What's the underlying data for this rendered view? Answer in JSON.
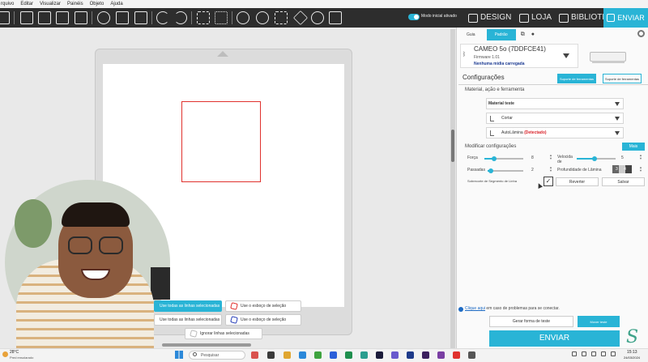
{
  "menubar": {
    "items": [
      "rquivo",
      "Editar",
      "Visualizar",
      "Painéis",
      "Objeto",
      "Ajuda"
    ]
  },
  "toolbar": {
    "icons": [
      "home-icon",
      "new-file-icon",
      "open-folder-icon",
      "save-icon",
      "print-icon",
      "cut-icon",
      "copy-icon",
      "paste-icon",
      "undo-icon",
      "redo-icon",
      "group-icon",
      "ungroup-icon",
      "zoom-in-icon",
      "zoom-out-icon",
      "zoom-fit-icon",
      "fill-page-icon",
      "pan-hand-icon",
      "move-icon"
    ],
    "mode_label": "Modo inicial ativado",
    "tabs": {
      "design": "DESIGN",
      "store": "LOJA",
      "library": "BIBLIOTECA",
      "send": "ENVIAR"
    }
  },
  "context_menu": {
    "items": [
      "Use todas as linhas selecionadas",
      "Use o esboço de seleção",
      "Use todas as linhas selecionadas",
      "Use o esboço de seleção",
      "Ignorar linhas selecionadas"
    ]
  },
  "panel": {
    "tabs": [
      "Guia",
      "Padrão"
    ],
    "device": {
      "name": "CAMEO 5o (7DDFCE41)",
      "firmware": "Firmware 1.01",
      "media": "Nenhuma mídia carregada"
    },
    "config_title": "Configurações",
    "tool_tabs": [
      "Suporte de ferramentas",
      "Suporte de ferramentas"
    ],
    "material_section": "Material, ação e ferramenta",
    "material": "Material teste",
    "action": "Cortar",
    "tool_name": "AutoLâmina",
    "tool_detected": "(Detectado)",
    "modify_title": "Modificar configurações",
    "more_button": "Mais",
    "force_label": "Força",
    "force_value": "8",
    "force_level": 0.25,
    "speed_label_1": "Velocida",
    "speed_label_2": "de",
    "speed_value": "5",
    "speed_level": 0.45,
    "passes_label": "Passadas",
    "passes_value": "2",
    "passes_level": 0.1,
    "depth_label": "Profundidade de Lâmina",
    "depth_value": "3 4",
    "overcut_label": "Sobrecorte de Segmento de Linha",
    "overcut_check": "✓",
    "revert_button": "Reverter",
    "save_button": "Salvar",
    "problems_link": "Clique aqui",
    "problems_text": " em caso de problemas para se conectar.",
    "test_button": "Gerar forma de teste",
    "move_button": "Mover teste",
    "send_button": "ENVIAR"
  },
  "taskbar": {
    "weather_temp": "28°C",
    "weather_desc": "Pred ensolarado",
    "search_placeholder": "Pesquisar",
    "time": "15:13",
    "date": "24/03/2024"
  }
}
